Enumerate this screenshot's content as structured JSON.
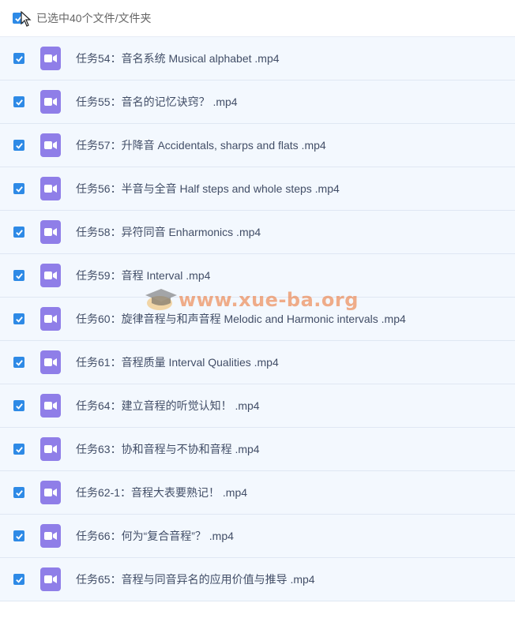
{
  "header": {
    "selection_label": "已选中40个文件/文件夹"
  },
  "watermark": {
    "text": "www.xue-ba.org"
  },
  "colors": {
    "checkbox": "#2e8ae6",
    "video_icon": "#8f7ee8",
    "row_bg": "#f3f8fe"
  },
  "files": [
    {
      "name": "任务54：音名系统 Musical alphabet .mp4",
      "icon": "video-icon",
      "checked": true
    },
    {
      "name": "任务55：音名的记忆诀窍？ .mp4",
      "icon": "video-icon",
      "checked": true
    },
    {
      "name": "任务57：升降音 Accidentals, sharps and flats .mp4",
      "icon": "video-icon",
      "checked": true
    },
    {
      "name": "任务56：半音与全音 Half steps and whole steps .mp4",
      "icon": "video-icon",
      "checked": true
    },
    {
      "name": "任务58：异符同音 Enharmonics .mp4",
      "icon": "video-icon",
      "checked": true
    },
    {
      "name": "任务59：音程 Interval .mp4",
      "icon": "video-icon",
      "checked": true
    },
    {
      "name": "任务60：旋律音程与和声音程 Melodic and Harmonic intervals .mp4",
      "icon": "video-icon",
      "checked": true
    },
    {
      "name": "任务61：音程质量 Interval Qualities .mp4",
      "icon": "video-icon",
      "checked": true
    },
    {
      "name": "任务64：建立音程的听觉认知！ .mp4",
      "icon": "video-icon",
      "checked": true
    },
    {
      "name": "任务63：协和音程与不协和音程 .mp4",
      "icon": "video-icon",
      "checked": true
    },
    {
      "name": "任务62-1：音程大表要熟记！ .mp4",
      "icon": "video-icon",
      "checked": true
    },
    {
      "name": "任务66：何为“复合音程”？ .mp4",
      "icon": "video-icon",
      "checked": true
    },
    {
      "name": "任务65：音程与同音异名的应用价值与推导 .mp4",
      "icon": "video-icon",
      "checked": true
    }
  ]
}
